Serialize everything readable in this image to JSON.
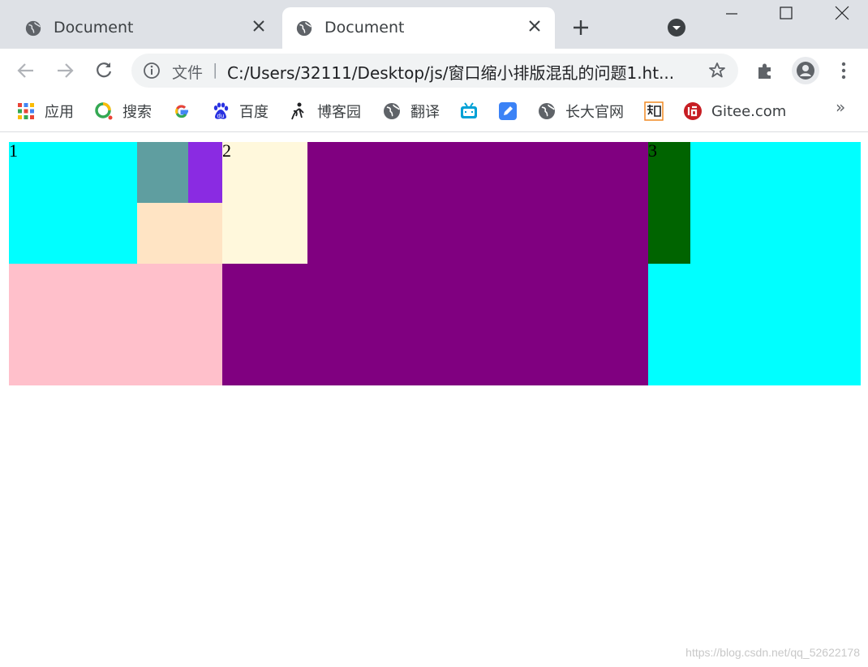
{
  "browser": {
    "tabs": [
      {
        "title": "Document",
        "active": false
      },
      {
        "title": "Document",
        "active": true
      }
    ],
    "omnibox": {
      "scheme_label": "文件",
      "separator": "|",
      "url": "C:/Users/32111/Desktop/js/窗口缩小排版混乱的问题1.ht..."
    },
    "bookmarks": [
      {
        "label": "应用",
        "icon": "apps-grid-icon"
      },
      {
        "label": "搜索",
        "icon": "search-logo-icon"
      },
      {
        "label": "",
        "icon": "google-icon"
      },
      {
        "label": "百度",
        "icon": "baidu-icon"
      },
      {
        "label": "博客园",
        "icon": "cnblogs-icon"
      },
      {
        "label": "翻译",
        "icon": "globe-icon"
      },
      {
        "label": "",
        "icon": "bilibili-icon"
      },
      {
        "label": "",
        "icon": "note-icon"
      },
      {
        "label": "长大官网",
        "icon": "globe-icon"
      },
      {
        "label": "",
        "icon": "zhihu-icon"
      },
      {
        "label": "Gitee.com",
        "icon": "gitee-icon"
      }
    ],
    "more_label": "»"
  },
  "page": {
    "blocks": [
      {
        "name": "block-1",
        "label": "1",
        "color": "#00ffff"
      },
      {
        "name": "block-small-cadet",
        "label": "",
        "color": "#5f9ea0"
      },
      {
        "name": "block-small-violet",
        "label": "",
        "color": "#8a2be2"
      },
      {
        "name": "block-small-bisque",
        "label": "",
        "color": "#ffe4c4"
      },
      {
        "name": "block-2",
        "label": "2",
        "color": "#fff8dc"
      },
      {
        "name": "block-purple",
        "label": "",
        "color": "#800080"
      },
      {
        "name": "block-3",
        "label": "3",
        "color": "#006400"
      },
      {
        "name": "block-right-cyan",
        "label": "",
        "color": "#00ffff"
      },
      {
        "name": "block-pink",
        "label": "",
        "color": "#ffc0cb"
      }
    ]
  },
  "watermark": "https://blog.csdn.net/qq_52622178"
}
